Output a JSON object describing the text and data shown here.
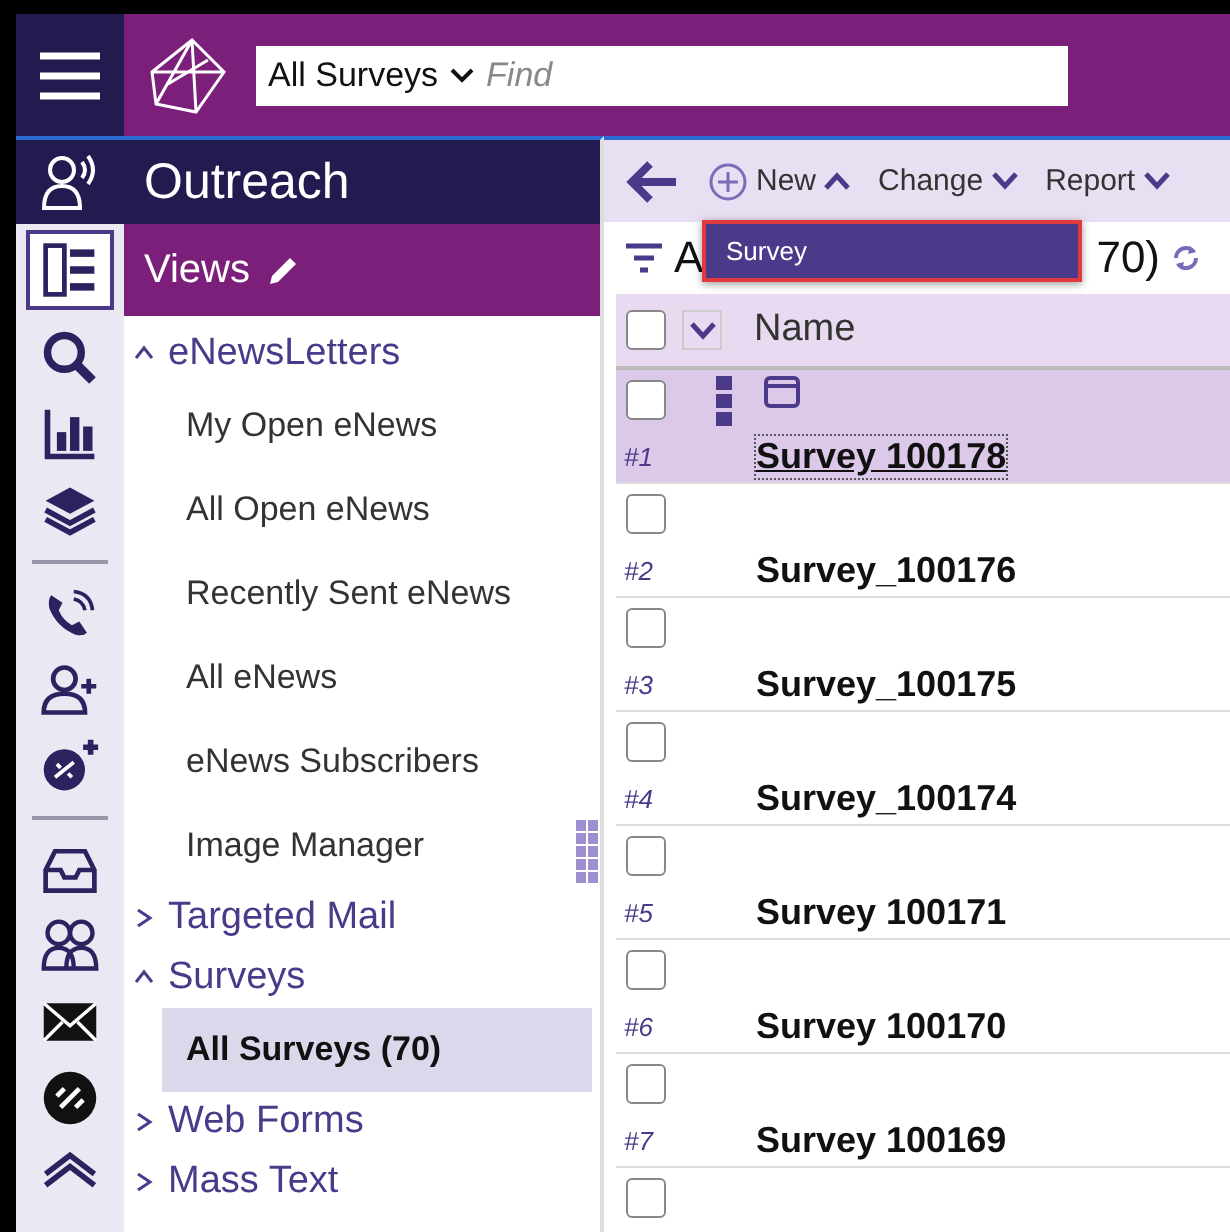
{
  "app_bar": {
    "scope": "All Surveys",
    "search": {
      "placeholder": "Find"
    }
  },
  "module": {
    "title": "Outreach"
  },
  "views": {
    "title": "Views"
  },
  "rail": [
    {
      "selected": true
    },
    {
      "selected": false
    },
    {
      "selected": false
    },
    {
      "selected": false
    },
    {
      "selected": false
    },
    {
      "selected": false
    },
    {
      "selected": false
    },
    {
      "selected": false
    },
    {
      "selected": false
    },
    {
      "selected": false
    },
    {
      "selected": false
    },
    {
      "selected": false
    }
  ],
  "nav": [
    {
      "label": "eNewsLetters",
      "expanded": true,
      "children": [
        {
          "label": "My Open eNews",
          "selected": false
        },
        {
          "label": "All Open eNews",
          "selected": false
        },
        {
          "label": "Recently Sent eNews",
          "selected": false
        },
        {
          "label": "All eNews",
          "selected": false
        },
        {
          "label": "eNews Subscribers",
          "selected": false
        },
        {
          "label": "Image Manager",
          "selected": false
        }
      ]
    },
    {
      "label": "Targeted Mail",
      "expanded": false
    },
    {
      "label": "Surveys",
      "expanded": true,
      "children": [
        {
          "label": "All Surveys (70)",
          "selected": true
        }
      ]
    },
    {
      "label": "Web Forms",
      "expanded": false
    },
    {
      "label": "Mass Text",
      "expanded": false
    }
  ],
  "toolbar": [
    {
      "label": "New",
      "kind": "add",
      "expanded": true
    },
    {
      "label": "Change",
      "kind": "menu",
      "expanded": false
    },
    {
      "label": "Report",
      "kind": "menu",
      "expanded": false
    }
  ],
  "new_menu": {
    "items": [
      {
        "label": "Survey",
        "selected": true
      }
    ]
  },
  "list_title": {
    "visible_start": "A",
    "visible_end": "70)"
  },
  "table": {
    "columns": [
      {
        "label": "Name"
      }
    ],
    "select_all_checked": false,
    "rows": [
      {
        "index": "#1",
        "name": "Survey 100178",
        "selected": true,
        "checked": false
      },
      {
        "index": "#2",
        "name": "Survey_100176",
        "selected": false,
        "checked": false
      },
      {
        "index": "#3",
        "name": "Survey_100175",
        "selected": false,
        "checked": false
      },
      {
        "index": "#4",
        "name": "Survey_100174",
        "selected": false,
        "checked": false
      },
      {
        "index": "#5",
        "name": "Survey 100171",
        "selected": false,
        "checked": false
      },
      {
        "index": "#6",
        "name": "Survey 100170",
        "selected": false,
        "checked": false
      },
      {
        "index": "#7",
        "name": "Survey 100169",
        "selected": false,
        "checked": false
      },
      {
        "selected": false,
        "checked": false
      }
    ]
  }
}
